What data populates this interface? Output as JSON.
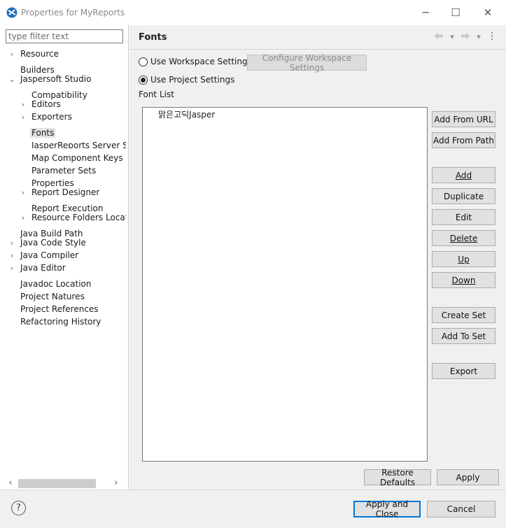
{
  "window": {
    "title": "Properties for MyReports",
    "minimize_glyph": "─",
    "maximize_glyph": "☐",
    "close_glyph": "✕"
  },
  "sidebar": {
    "filter_placeholder": "type filter text",
    "items": [
      {
        "label": "Resource",
        "arrow": "›"
      },
      {
        "label": "Builders",
        "arrow": ""
      },
      {
        "label": "Jaspersoft Studio",
        "arrow": "⌄"
      },
      {
        "label": "Compatibility",
        "arrow": ""
      },
      {
        "label": "Editors",
        "arrow": "›"
      },
      {
        "label": "Exporters",
        "arrow": "›"
      },
      {
        "label": "Fonts",
        "arrow": ""
      },
      {
        "label": "JasperReports Server Set",
        "arrow": ""
      },
      {
        "label": "Map Component Keys",
        "arrow": ""
      },
      {
        "label": "Parameter Sets",
        "arrow": ""
      },
      {
        "label": "Properties",
        "arrow": ""
      },
      {
        "label": "Report Designer",
        "arrow": "›"
      },
      {
        "label": "Report Execution",
        "arrow": ""
      },
      {
        "label": "Resource Folders Locatic",
        "arrow": "›"
      },
      {
        "label": "Java Build Path",
        "arrow": ""
      },
      {
        "label": "Java Code Style",
        "arrow": "›"
      },
      {
        "label": "Java Compiler",
        "arrow": "›"
      },
      {
        "label": "Java Editor",
        "arrow": "›"
      },
      {
        "label": "Javadoc Location",
        "arrow": ""
      },
      {
        "label": "Project Natures",
        "arrow": ""
      },
      {
        "label": "Project References",
        "arrow": ""
      },
      {
        "label": "Refactoring History",
        "arrow": ""
      }
    ],
    "selected": "Fonts",
    "scroll_left_glyph": "‹",
    "scroll_right_glyph": "›"
  },
  "page": {
    "title": "Fonts",
    "nav": {
      "back": "⇦",
      "back_menu": "▾",
      "forward": "⇨",
      "forward_menu": "▾",
      "more": "⋮"
    },
    "use_workspace_label": "Use Workspace Settings",
    "configure_workspace_label": "Configure Workspace Settings",
    "use_project_label": "Use Project Settings",
    "font_list_label": "Font List",
    "fonts": [
      "맑은고딕Jasper"
    ],
    "buttons": {
      "add_from_url": "Add From URL",
      "add_from_path": "Add From Path",
      "add": "Add",
      "duplicate": "Duplicate",
      "edit": "Edit",
      "delete": "Delete",
      "up": "Up",
      "down": "Down",
      "create_set": "Create Set",
      "add_to_set": "Add To Set",
      "export": "Export"
    },
    "restore_defaults": "Restore Defaults",
    "apply": "Apply"
  },
  "footer": {
    "help_glyph": "?",
    "apply_and_close": "Apply and Close",
    "cancel": "Cancel"
  },
  "colors": {
    "accent": "#0078d7",
    "panel_bg": "#f0f0f0"
  }
}
